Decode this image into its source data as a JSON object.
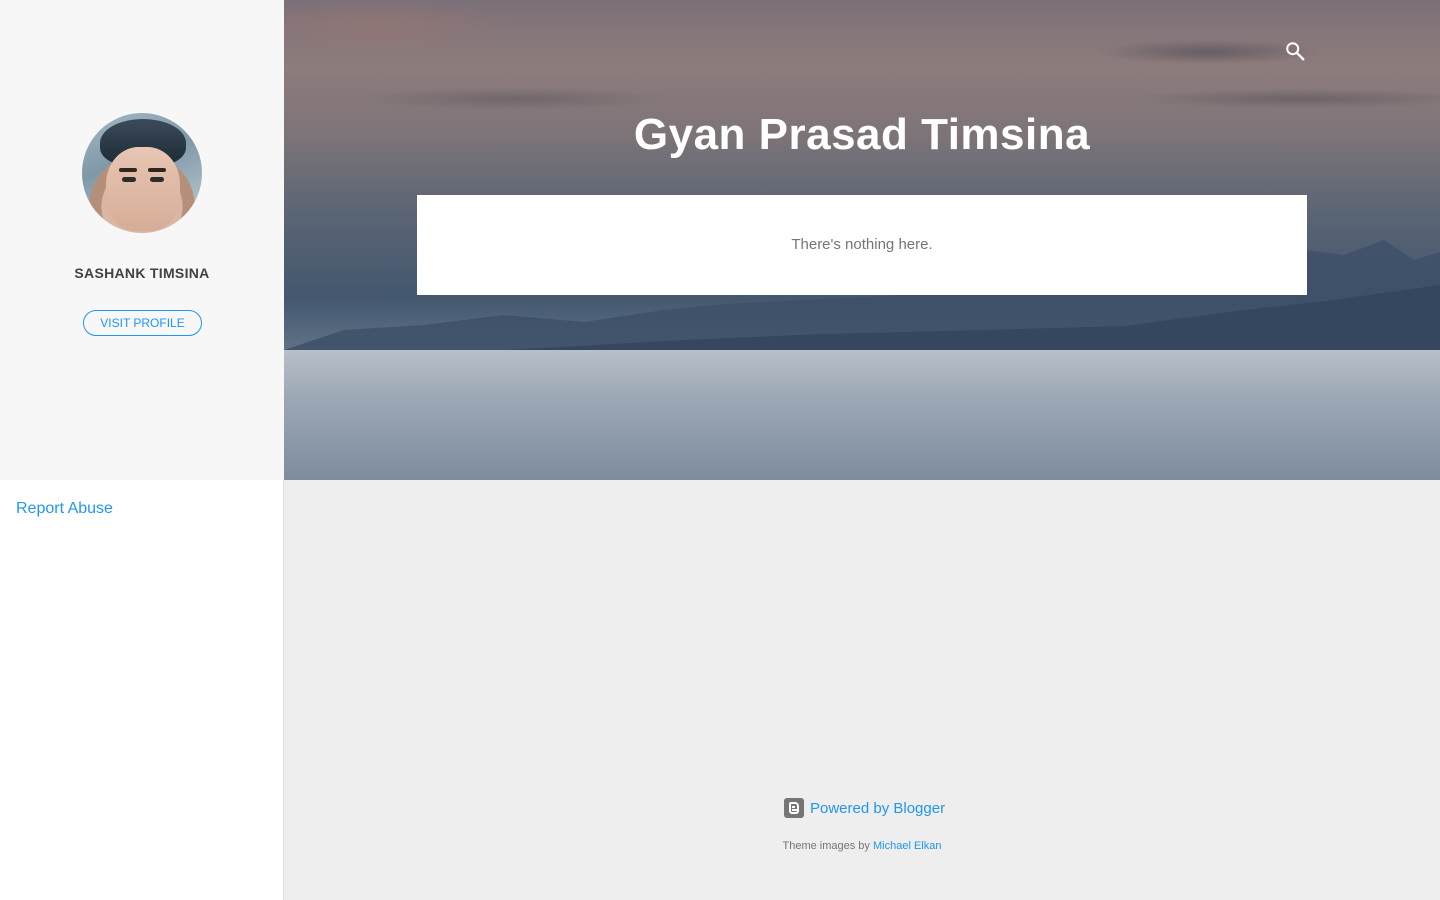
{
  "sidebar": {
    "profile": {
      "name": "SASHANK TIMSINA",
      "visit_label": "VISIT PROFILE",
      "avatar_icon": "profile-photo"
    },
    "report_abuse": "Report Abuse"
  },
  "header": {
    "title": "Gyan Prasad Timsina",
    "search_icon": "search-icon"
  },
  "main": {
    "empty_message": "There's nothing here."
  },
  "footer": {
    "powered_by": "Powered by Blogger",
    "theme_images_prefix": "Theme images by",
    "theme_images_author": "Michael Elkan"
  },
  "colors": {
    "accent": "#2196f3",
    "sidebar_bg": "#f7f7f7",
    "page_bg": "#eeeeee",
    "title": "#ffffff",
    "muted_text": "#757575"
  }
}
